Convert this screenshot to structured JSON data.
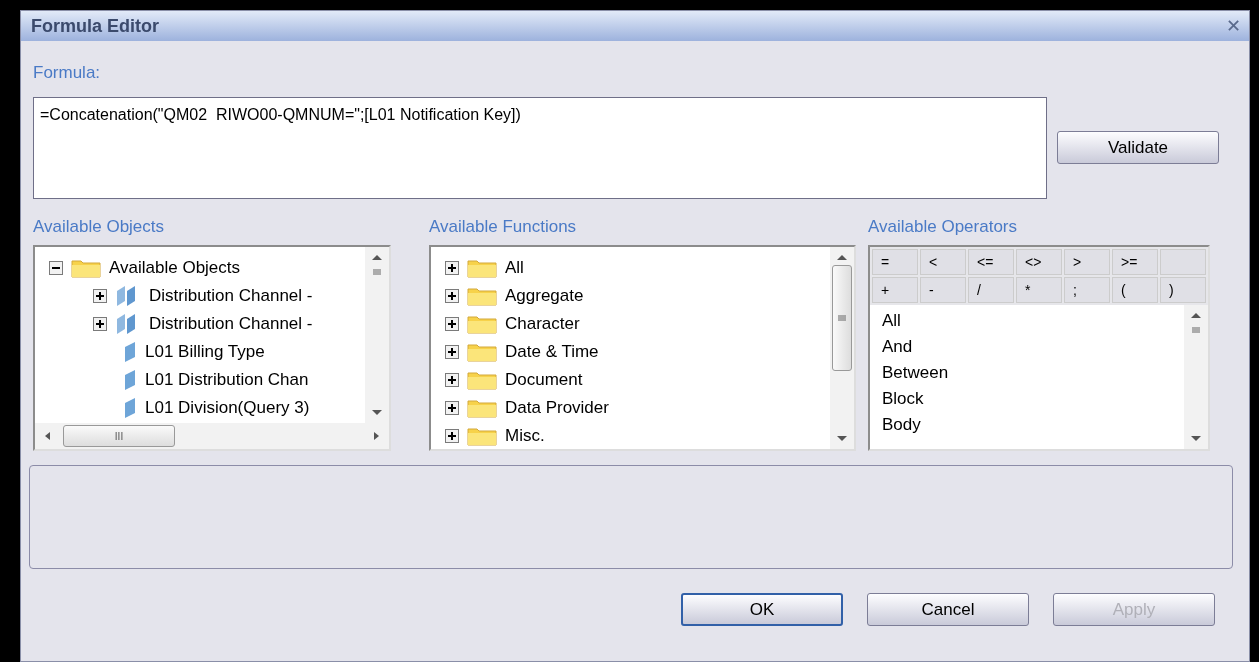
{
  "window": {
    "title": "Formula Editor",
    "close": "✕"
  },
  "formula": {
    "label": "Formula:",
    "value": "=Concatenation(\"QM02  RIWO00-QMNUM=\";[L01 Notification Key])"
  },
  "validate_button": {
    "label": "Validate"
  },
  "objects": {
    "label": "Available Objects",
    "tree": [
      {
        "label": "Available Objects",
        "kind": "folder",
        "expanded": true,
        "children": [
          {
            "label": "Distribution Channel -",
            "kind": "dimension",
            "expanded": false
          },
          {
            "label": "Distribution Channel -",
            "kind": "dimension",
            "expanded": false
          },
          {
            "label": "L01 Billing Type",
            "kind": "detail"
          },
          {
            "label": "L01 Distribution Chan",
            "kind": "detail"
          },
          {
            "label": "L01 Division(Query 3)",
            "kind": "detail"
          }
        ]
      }
    ],
    "hscroll_grip": "III"
  },
  "functions": {
    "label": "Available Functions",
    "items": [
      {
        "label": "All",
        "expanded": false
      },
      {
        "label": "Aggregate",
        "expanded": false
      },
      {
        "label": "Character",
        "expanded": false
      },
      {
        "label": "Date & Time",
        "expanded": false
      },
      {
        "label": "Document",
        "expanded": false
      },
      {
        "label": "Data Provider",
        "expanded": false
      },
      {
        "label": "Misc.",
        "expanded": false
      }
    ]
  },
  "operators": {
    "label": "Available Operators",
    "symbols": [
      [
        "=",
        "<",
        "<=",
        "<>",
        ">",
        ">="
      ],
      [
        "+",
        "-",
        "/",
        "*",
        ";",
        "(",
        ")"
      ]
    ],
    "items": [
      "All",
      "And",
      "Between",
      "Block",
      "Body"
    ]
  },
  "buttons": [
    {
      "label": "OK",
      "default": true,
      "disabled": false
    },
    {
      "label": "Cancel",
      "default": false,
      "disabled": false
    },
    {
      "label": "Apply",
      "default": false,
      "disabled": true
    }
  ]
}
